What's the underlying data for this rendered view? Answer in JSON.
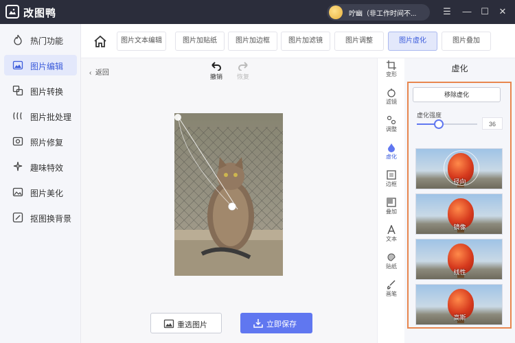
{
  "app": {
    "name": "改图鸭"
  },
  "user": {
    "name": "咛幽（非工作时间不..."
  },
  "window_controls": [
    "minimize-icon",
    "menu-icon",
    "close-icon"
  ],
  "sidebar": {
    "items": [
      {
        "label": "热门功能",
        "icon": "fire-icon"
      },
      {
        "label": "图片编辑",
        "icon": "image-edit-icon",
        "active": true
      },
      {
        "label": "图片转换",
        "icon": "convert-icon"
      },
      {
        "label": "图片批处理",
        "icon": "batch-icon"
      },
      {
        "label": "照片修复",
        "icon": "repair-icon"
      },
      {
        "label": "趣味特效",
        "icon": "sparkle-icon"
      },
      {
        "label": "图片美化",
        "icon": "beautify-icon"
      },
      {
        "label": "抠图换背景",
        "icon": "cutout-icon"
      }
    ]
  },
  "toolbar": {
    "tabs": [
      {
        "label": "图片文本编辑"
      },
      {
        "label": "图片加贴纸"
      },
      {
        "label": "图片加边框"
      },
      {
        "label": "图片加滤镜"
      },
      {
        "label": "图片调整"
      },
      {
        "label": "图片虚化",
        "active": true
      },
      {
        "label": "图片叠加"
      }
    ]
  },
  "canvas": {
    "back_label": "返回",
    "undo_label": "撤销",
    "redo_label": "恢复",
    "reselect_label": "重选图片",
    "save_label": "立即保存"
  },
  "toolstrip": {
    "items": [
      {
        "label": "变形",
        "icon": "crop-icon"
      },
      {
        "label": "滤镜",
        "icon": "filter-icon"
      },
      {
        "label": "调整",
        "icon": "adjust-icon"
      },
      {
        "label": "虚化",
        "icon": "blur-drop-icon",
        "active": true
      },
      {
        "label": "边框",
        "icon": "frame-icon"
      },
      {
        "label": "叠加",
        "icon": "overlay-icon"
      },
      {
        "label": "文本",
        "icon": "text-icon"
      },
      {
        "label": "贴纸",
        "icon": "sticker-icon"
      },
      {
        "label": "画笔",
        "icon": "brush-icon"
      }
    ]
  },
  "panel": {
    "title": "虚化",
    "remove_label": "移除虚化",
    "strength_label": "虚化强度",
    "strength_value": "36",
    "strength_fraction": 0.36,
    "presets": [
      {
        "label": "径向"
      },
      {
        "label": "镜像"
      },
      {
        "label": "线性"
      },
      {
        "label": "高斯"
      }
    ]
  },
  "colors": {
    "accent": "#6077f0",
    "highlight_border": "#e8864d",
    "titlebar": "#2b2d3b"
  }
}
